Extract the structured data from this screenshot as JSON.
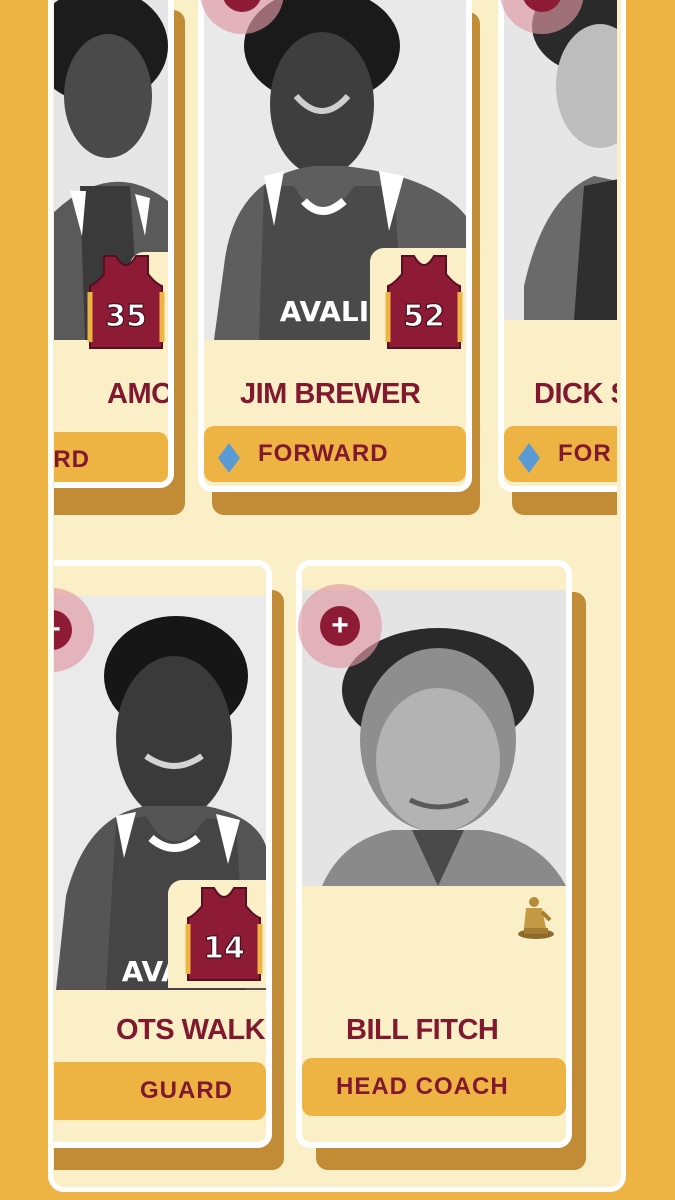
{
  "colors": {
    "background": "#EDB444",
    "panel": "#FBEFC7",
    "accent": "#80192F",
    "position_button": "#EDB444",
    "diamond": "#5B9BD5"
  },
  "cards": [
    {
      "id": "card-1",
      "name": "AMONS",
      "jersey": "35",
      "position": "RD",
      "position_icon": "diamond-icon"
    },
    {
      "id": "card-2",
      "name": "JIM BREWER",
      "jersey": "52",
      "position": "FORWARD",
      "position_icon": "diamond-icon"
    },
    {
      "id": "card-3",
      "name": "DICK S",
      "jersey": "",
      "position": "FOR",
      "position_icon": "diamond-icon"
    },
    {
      "id": "card-4",
      "name": "OTS WALKER",
      "jersey": "14",
      "position": "GUARD",
      "position_icon": ""
    },
    {
      "id": "card-5",
      "name": "BILL FITCH",
      "jersey": "",
      "position": "HEAD COACH",
      "badge_icon": "trophy-statue-icon"
    }
  ],
  "add_button_label": "+"
}
